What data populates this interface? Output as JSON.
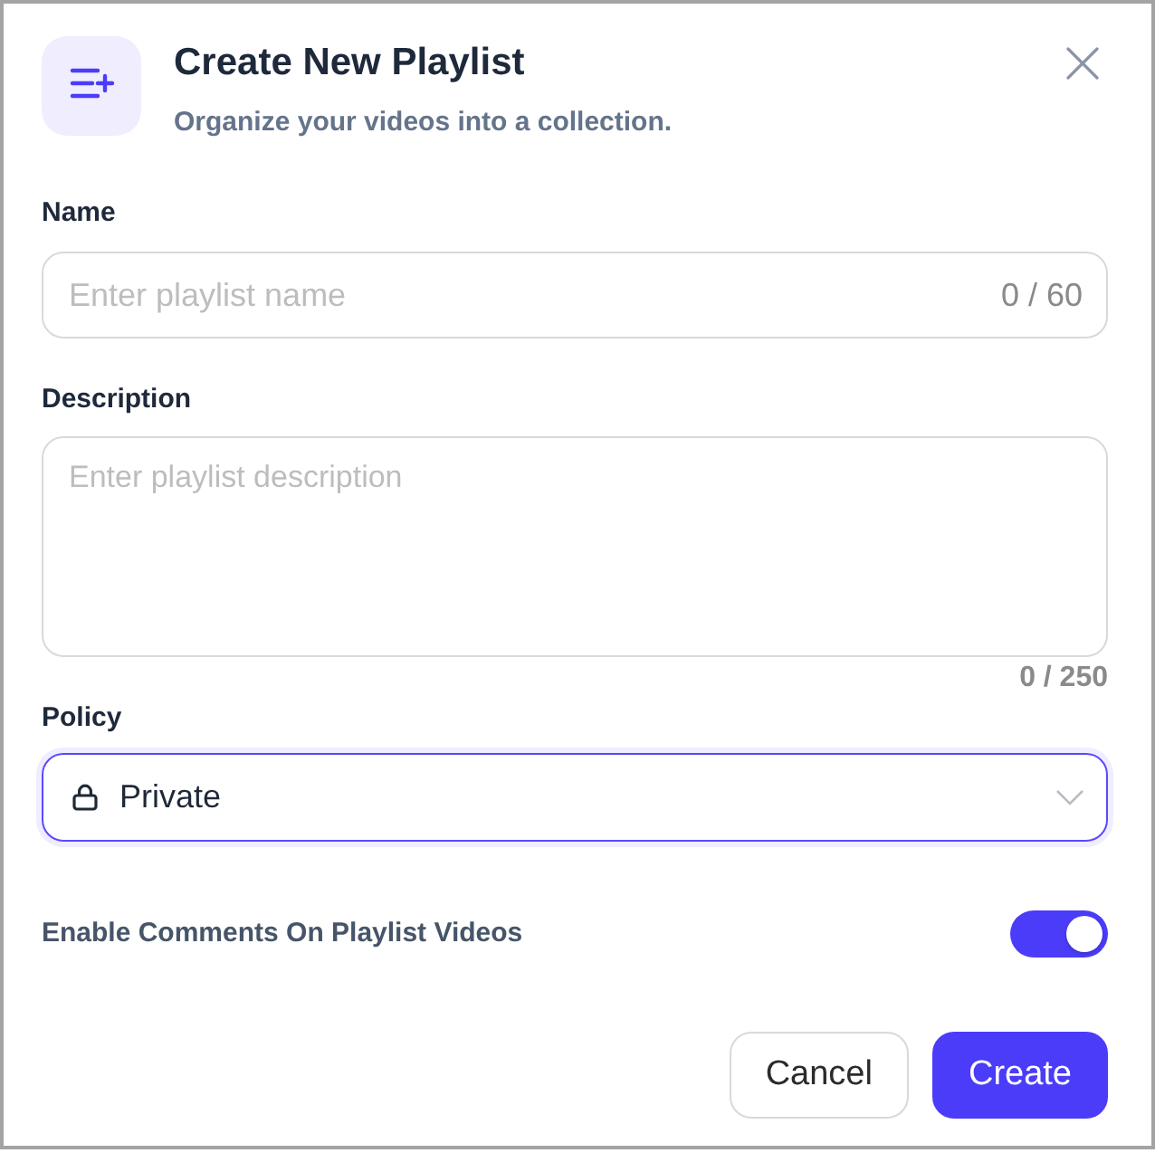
{
  "dialog": {
    "title": "Create New Playlist",
    "subtitle": "Organize your videos into a collection."
  },
  "fields": [
    {
      "kind": "text",
      "label": "Name",
      "placeholder": "Enter playlist name",
      "counter": "0 / 60"
    },
    {
      "kind": "textarea",
      "label": "Description",
      "placeholder": "Enter playlist description",
      "counter": "0 / 250"
    },
    {
      "kind": "select",
      "label": "Policy",
      "value": "Private",
      "focused": true
    }
  ],
  "toggle": {
    "label": "Enable Comments On Playlist Videos",
    "on": true
  },
  "buttons": [
    {
      "label": "Cancel",
      "kind": "secondary"
    },
    {
      "label": "Create",
      "kind": "primary"
    }
  ]
}
